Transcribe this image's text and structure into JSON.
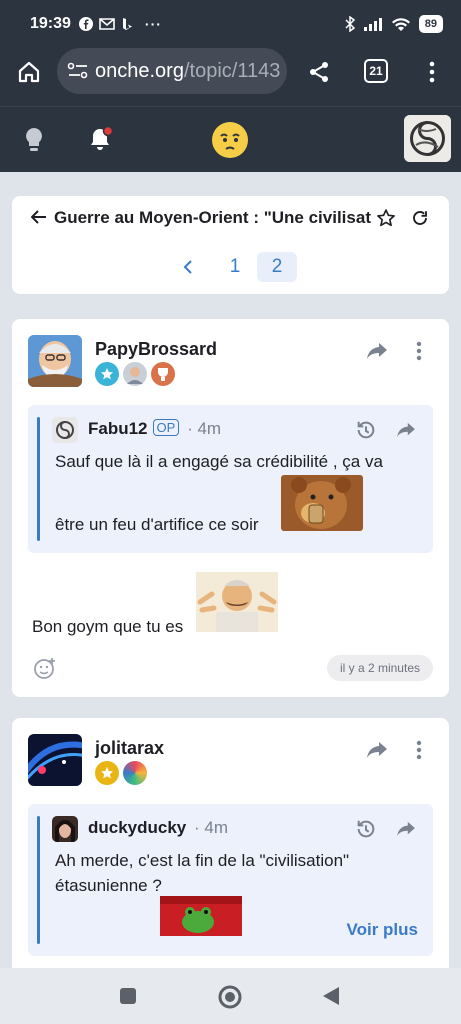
{
  "status": {
    "time": "19:39",
    "battery": "89"
  },
  "browser": {
    "url_host": "onche.org",
    "url_path": "/topic/1143",
    "tab_count": "21"
  },
  "topic": {
    "title": "Guerre au Moyen-Orient : \"Une civilisati",
    "pages": [
      "1",
      "2"
    ],
    "current_page": "2"
  },
  "posts": [
    {
      "username": "PapyBrossard",
      "quote": {
        "username": "Fabu12",
        "op_label": "OP",
        "time": "· 4m",
        "line1": "Sauf que là il a engagé sa crédibilité , ça va",
        "line2": "être un feu d'artifice ce soir"
      },
      "text": "Bon goym que tu es",
      "timestamp": "il y a 2 minutes"
    },
    {
      "username": "jolitarax",
      "quote": {
        "username": "duckyducky",
        "time": "· 4m",
        "line1": "Ah merde, c'est la fin de la \"civilisation\"",
        "line2": "étasunienne ?"
      },
      "more_label": "Voir plus"
    }
  ],
  "colors": {
    "header": "#2c3440",
    "accent": "#3a7bc8",
    "quote_bg": "#edf1fc",
    "page_bg": "#dfe3ea"
  }
}
